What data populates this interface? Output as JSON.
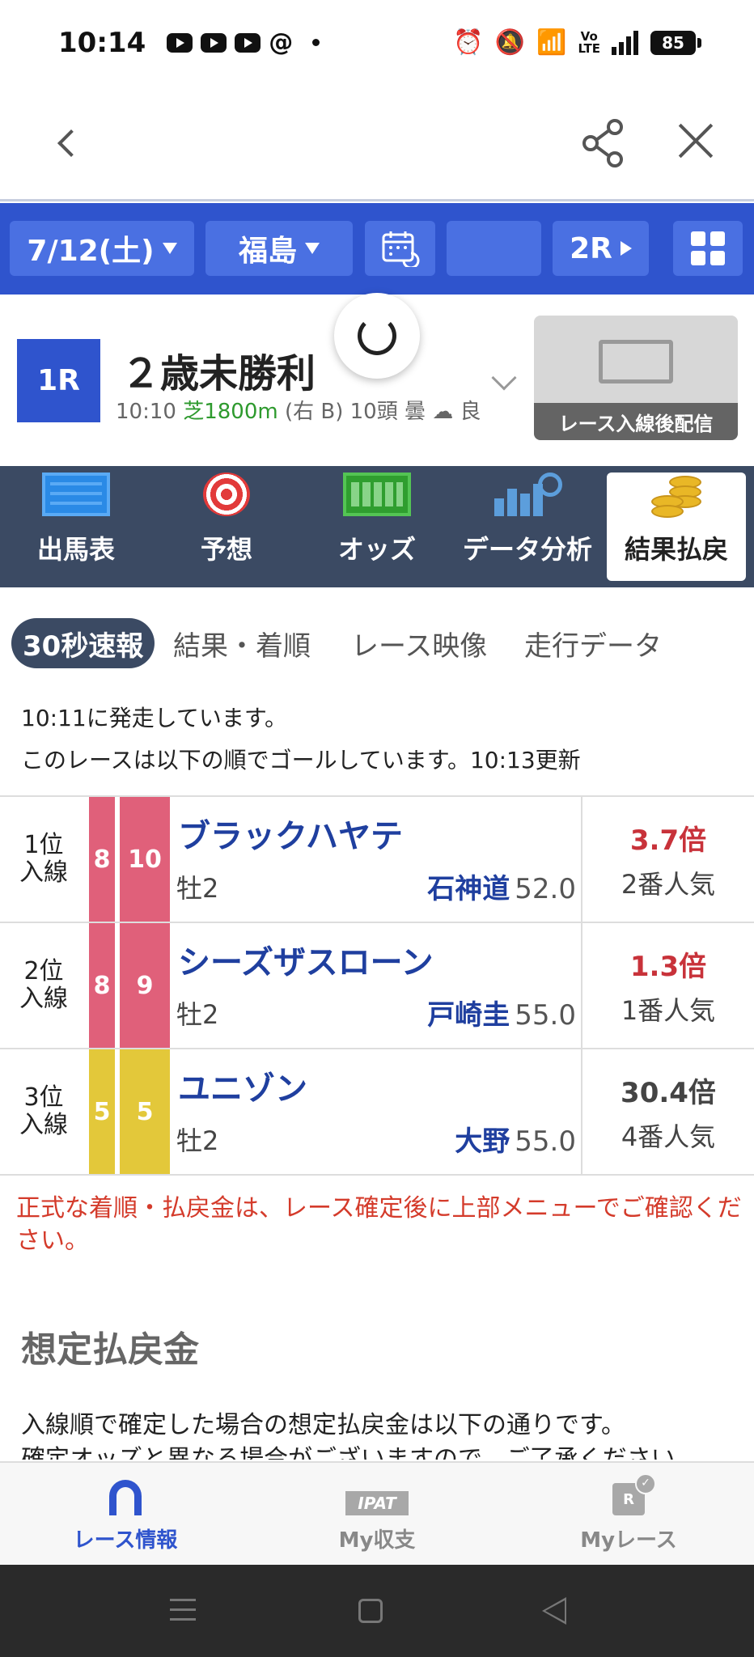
{
  "status_bar": {
    "time": "10:14",
    "battery": "85",
    "volte": "Vo\nLTE",
    "icons": [
      "youtube-icon",
      "youtube-icon",
      "youtube-icon",
      "threads-icon",
      "alarm-icon",
      "mute-icon",
      "wifi-icon",
      "signal-icon",
      "battery-icon"
    ]
  },
  "filter_bar": {
    "date": "7/12(土)",
    "venue": "福島",
    "next_race": "2R",
    "accent": "#2f54cd"
  },
  "race": {
    "number": "1R",
    "name": "２歳未勝利",
    "time": "10:10",
    "course": "芝1800m",
    "direction": "(右 B)",
    "horses": "10頭",
    "weather": "曇",
    "condition": "良",
    "video_label": "レース入線後配信"
  },
  "categories": [
    {
      "label": "出馬表",
      "icon": "entries-icon"
    },
    {
      "label": "予想",
      "icon": "target-icon"
    },
    {
      "label": "オッズ",
      "icon": "odds-board-icon"
    },
    {
      "label": "データ分析",
      "icon": "data-analysis-icon"
    },
    {
      "label": "結果払戻",
      "icon": "coins-icon",
      "active": true
    }
  ],
  "subtabs": [
    "30秒速報",
    "結果・着順",
    "レース映像",
    "走行データ"
  ],
  "messages": {
    "started": "10:11に発走しています。",
    "goal_order": "このレースは以下の順でゴールしています。10:13更新"
  },
  "results": [
    {
      "rank": "1位",
      "rank_sub": "入線",
      "waku": "8",
      "umaban": "10",
      "waku_color": "#e0607a",
      "name": "ブラックハヤテ",
      "sex_age": "牡2",
      "jockey": "石神道",
      "weight": "52.0",
      "odds": "3.7倍",
      "odds_color": "#c8323a",
      "popularity": "2番人気"
    },
    {
      "rank": "2位",
      "rank_sub": "入線",
      "waku": "8",
      "umaban": "9",
      "waku_color": "#e0607a",
      "name": "シーズザスローン",
      "sex_age": "牡2",
      "jockey": "戸崎圭",
      "weight": "55.0",
      "odds": "1.3倍",
      "odds_color": "#c8323a",
      "popularity": "1番人気"
    },
    {
      "rank": "3位",
      "rank_sub": "入線",
      "waku": "5",
      "umaban": "5",
      "waku_color": "#e3c83a",
      "name": "ユニゾン",
      "sex_age": "牡2",
      "jockey": "大野",
      "weight": "55.0",
      "odds": "30.4倍",
      "odds_color": "#444444",
      "popularity": "4番人気"
    }
  ],
  "notice": "正式な着順・払戻金は、レース確定後に上部メニューでご確認ください。",
  "payout_section": {
    "title": "想定払戻金",
    "line1": "入線順で確定した場合の想定払戻金は以下の通りです。",
    "line2": "確定オッズと異なる場合がございますので、ご了承ください。"
  },
  "tabbar": [
    {
      "label": "レース情報",
      "active": true
    },
    {
      "label": "My収支",
      "icon_text": "IPAT"
    },
    {
      "label": "Myレース",
      "icon_text": "R"
    }
  ]
}
